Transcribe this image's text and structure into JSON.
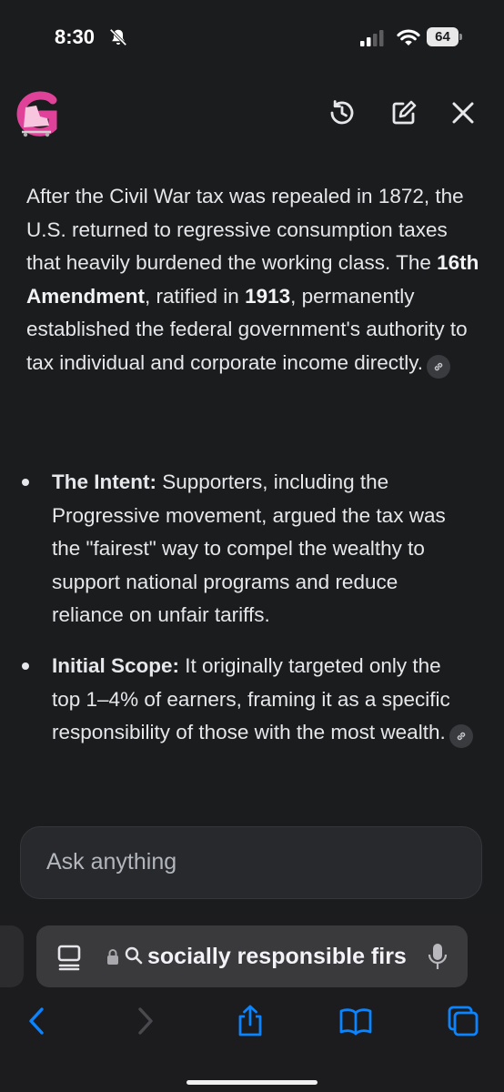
{
  "status_bar": {
    "time": "8:30",
    "battery": "64"
  },
  "header": {
    "logo_icon": "g-skate-logo-icon",
    "history_icon": "history-icon",
    "edit_icon": "new-chat-icon",
    "close_icon": "close-icon"
  },
  "content": {
    "paragraph": {
      "part1": "After the Civil War tax was repealed in 1872, the U.S. returned to regressive consumption taxes that heavily burdened the working class. The ",
      "bold1": "16th Amendment",
      "part2": ", ratified in ",
      "bold2": "1913",
      "part3": ", permanently established the federal government's authority to tax individual and corporate income directly."
    },
    "bullets": [
      {
        "title": "The Intent:",
        "text": " Supporters, including the Progressive movement, argued the tax was the \"fairest\" way to compel the wealthy to support national programs and reduce reliance on unfair tariffs."
      },
      {
        "title": "Initial Scope:",
        "text": " It originally targeted only the top 1–4% of earners, framing it as a specific responsibility of those with the most wealth."
      }
    ]
  },
  "ask": {
    "placeholder": "Ask anything"
  },
  "browser": {
    "url_text": "socially responsible firs",
    "icons": [
      "reader-icon",
      "lock-icon",
      "search-icon",
      "mic-icon",
      "back-icon",
      "forward-icon",
      "share-icon",
      "bookmarks-icon",
      "tabs-icon"
    ]
  },
  "colors": {
    "background": "#1b1c1e",
    "accent_blue": "#0a84ff",
    "logo_pink": "#e0429a"
  }
}
